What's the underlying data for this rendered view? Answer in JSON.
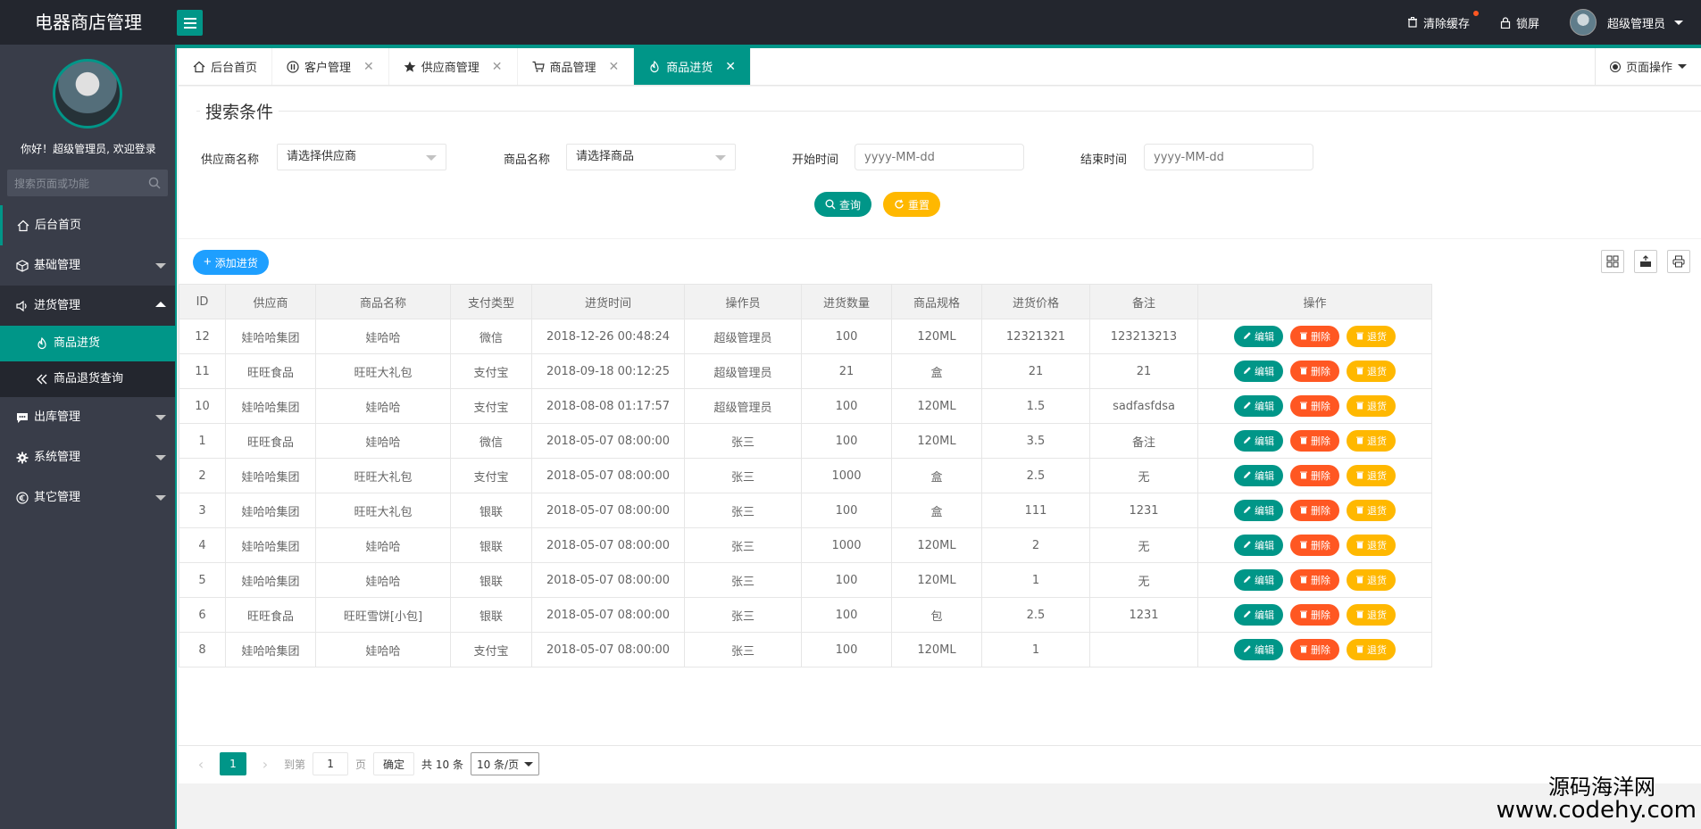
{
  "header": {
    "app_title": "电器商店管理",
    "clear_cache": "清除缓存",
    "lock_screen": "锁屏",
    "user": "超级管理员"
  },
  "sidebar": {
    "welcome": "你好！超级管理员, 欢迎登录",
    "search_placeholder": "搜索页面或功能",
    "items": [
      {
        "label": "后台首页",
        "icon": "home-icon"
      },
      {
        "label": "基础管理",
        "icon": "cube-icon"
      },
      {
        "label": "进货管理",
        "icon": "speaker-icon"
      },
      {
        "label": "出库管理",
        "icon": "chat-icon"
      },
      {
        "label": "系统管理",
        "icon": "gear-icon"
      },
      {
        "label": "其它管理",
        "icon": "euro-icon"
      }
    ],
    "sub_items": [
      {
        "label": "商品进货",
        "icon": "fire-icon"
      },
      {
        "label": "商品退货查询",
        "icon": "double-chevron-left-icon"
      }
    ]
  },
  "tabs": [
    {
      "label": "后台首页",
      "icon": "home-icon"
    },
    {
      "label": "客户管理",
      "icon": "pause-icon"
    },
    {
      "label": "供应商管理",
      "icon": "star-icon"
    },
    {
      "label": "商品管理",
      "icon": "cart-icon"
    },
    {
      "label": "商品进货",
      "icon": "fire-icon"
    }
  ],
  "page_ops": "页面操作",
  "search": {
    "legend": "搜索条件",
    "supplier_label": "供应商名称",
    "supplier_value": "请选择供应商",
    "goods_label": "商品名称",
    "goods_value": "请选择商品",
    "start_label": "开始时间",
    "start_placeholder": "yyyy-MM-dd",
    "end_label": "结束时间",
    "end_placeholder": "yyyy-MM-dd",
    "query_btn": "查询",
    "reset_btn": "重置"
  },
  "toolbar": {
    "add_btn": "添加进货"
  },
  "table": {
    "columns": [
      "ID",
      "供应商",
      "商品名称",
      "支付类型",
      "进货时间",
      "操作员",
      "进货数量",
      "商品规格",
      "进货价格",
      "备注",
      "操作"
    ],
    "rows": [
      [
        "12",
        "娃哈哈集团",
        "娃哈哈",
        "微信",
        "2018-12-26 00:48:24",
        "超级管理员",
        "100",
        "120ML",
        "12321321",
        "123213213"
      ],
      [
        "11",
        "旺旺食品",
        "旺旺大礼包",
        "支付宝",
        "2018-09-18 00:12:25",
        "超级管理员",
        "21",
        "盒",
        "21",
        "21"
      ],
      [
        "10",
        "娃哈哈集团",
        "娃哈哈",
        "支付宝",
        "2018-08-08 01:17:57",
        "超级管理员",
        "100",
        "120ML",
        "1.5",
        "sadfasfdsa"
      ],
      [
        "1",
        "旺旺食品",
        "娃哈哈",
        "微信",
        "2018-05-07 08:00:00",
        "张三",
        "100",
        "120ML",
        "3.5",
        "备注"
      ],
      [
        "2",
        "娃哈哈集团",
        "旺旺大礼包",
        "支付宝",
        "2018-05-07 08:00:00",
        "张三",
        "1000",
        "盒",
        "2.5",
        "无"
      ],
      [
        "3",
        "娃哈哈集团",
        "旺旺大礼包",
        "银联",
        "2018-05-07 08:00:00",
        "张三",
        "100",
        "盒",
        "111",
        "1231"
      ],
      [
        "4",
        "娃哈哈集团",
        "娃哈哈",
        "银联",
        "2018-05-07 08:00:00",
        "张三",
        "1000",
        "120ML",
        "2",
        "无"
      ],
      [
        "5",
        "娃哈哈集团",
        "娃哈哈",
        "银联",
        "2018-05-07 08:00:00",
        "张三",
        "100",
        "120ML",
        "1",
        "无"
      ],
      [
        "6",
        "旺旺食品",
        "旺旺雪饼[小包]",
        "银联",
        "2018-05-07 08:00:00",
        "张三",
        "100",
        "包",
        "2.5",
        "1231"
      ],
      [
        "8",
        "娃哈哈集团",
        "娃哈哈",
        "支付宝",
        "2018-05-07 08:00:00",
        "张三",
        "100",
        "120ML",
        "1",
        ""
      ]
    ],
    "actions": {
      "edit": "编辑",
      "delete": "删除",
      "return": "退货"
    }
  },
  "pager": {
    "current": "1",
    "goto_label": "到第",
    "goto_value": "1",
    "page_unit": "页",
    "confirm": "确定",
    "total": "共 10 条",
    "page_size": "10 条/页"
  },
  "watermark": {
    "cn": "源码海洋网",
    "url": "www.codehy.com"
  },
  "colors": {
    "primary": "#009688",
    "danger": "#ff5722",
    "warning": "#ffb800",
    "info": "#1e9fff",
    "sidebar": "#393d49",
    "header": "#23262e"
  }
}
